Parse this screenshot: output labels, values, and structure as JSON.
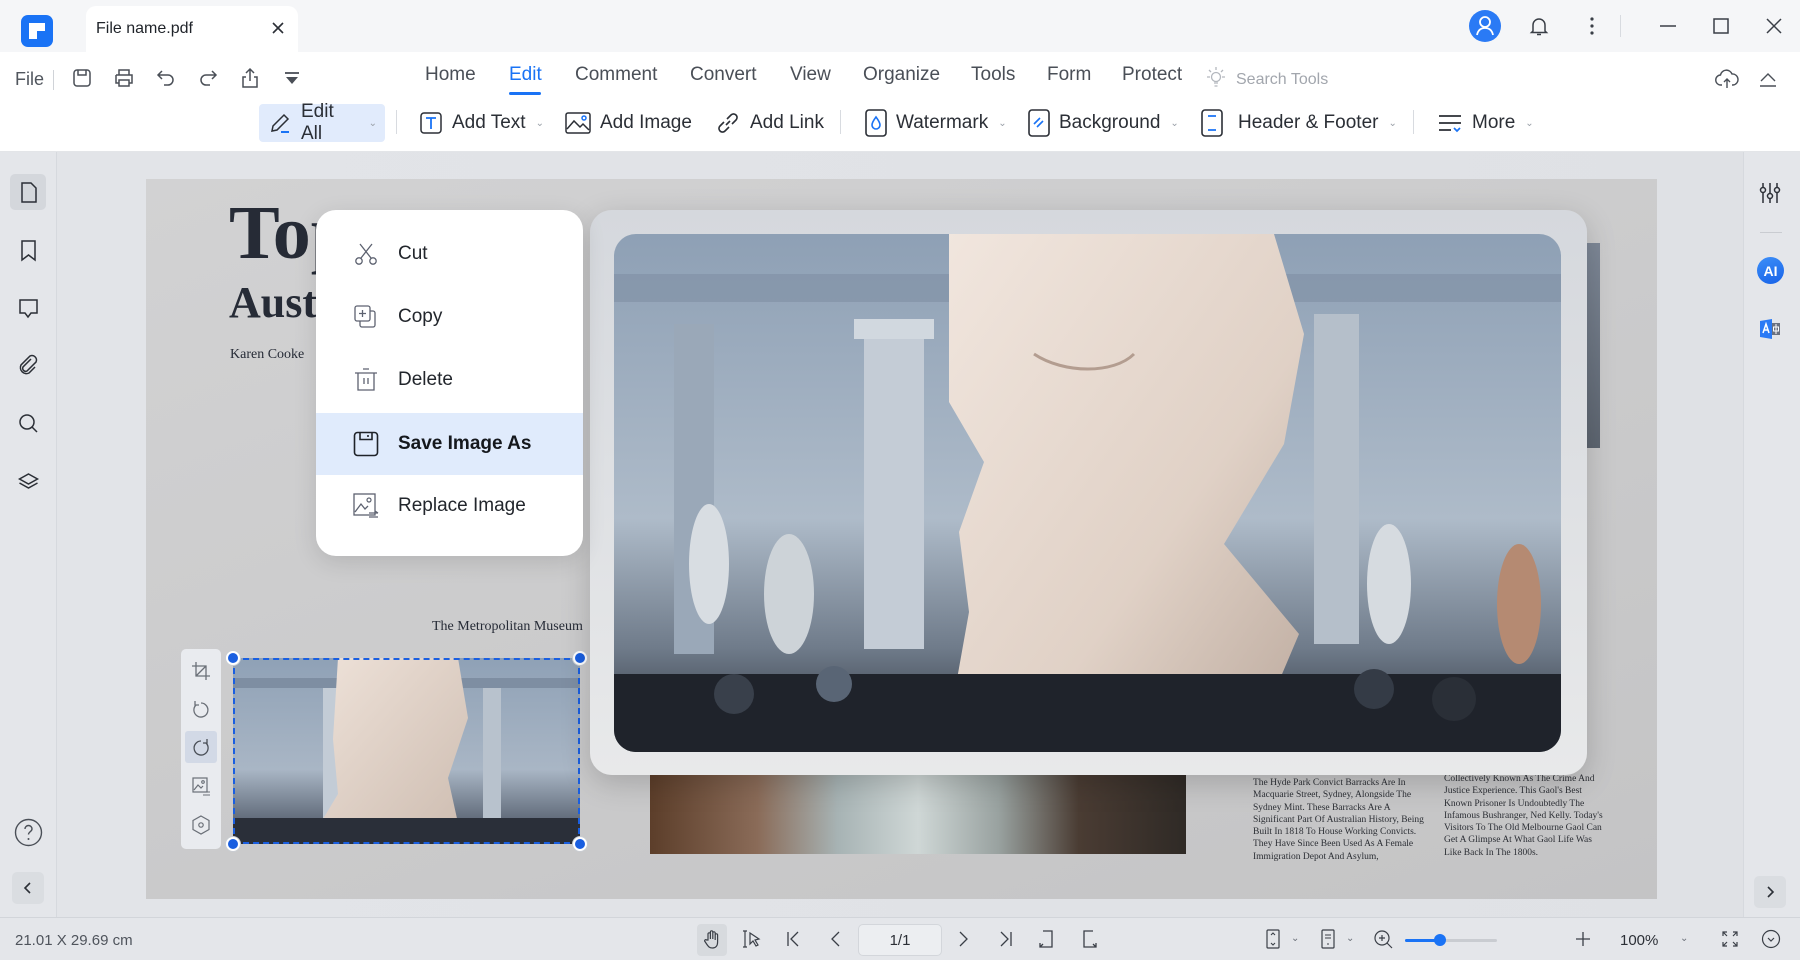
{
  "window": {
    "tab_title": "File name.pdf",
    "controls": [
      "minimize",
      "maximize",
      "close"
    ]
  },
  "ribbon": {
    "file_label": "File",
    "quick_actions": [
      "save-icon",
      "print-icon",
      "undo-icon",
      "redo-icon",
      "share-icon",
      "customize-icon"
    ],
    "menu_tabs": [
      {
        "label": "Home"
      },
      {
        "label": "Edit",
        "active": true
      },
      {
        "label": "Comment"
      },
      {
        "label": "Convert"
      },
      {
        "label": "View"
      },
      {
        "label": "Organize"
      },
      {
        "label": "Tools"
      },
      {
        "label": "Form"
      },
      {
        "label": "Protect"
      }
    ],
    "search_placeholder": "Search Tools",
    "tools": {
      "edit_all": "Edit All",
      "add_text": "Add Text",
      "add_image": "Add Image",
      "add_link": "Add Link",
      "watermark": "Watermark",
      "background": "Background",
      "header_footer": "Header & Footer",
      "more": "More"
    },
    "caret": "⌄"
  },
  "document": {
    "title": "Top",
    "subtitle": "Austr",
    "author": "Karen Cooke",
    "image_caption": "The Metropolitan Museum",
    "paragraph_1": "The Hyde Park Convict Barracks Are In Macquarie Street, Sydney, Alongside The Sydney Mint. These Barracks Are A Significant Part Of Australian History, Being Built In 1818 To House Working Convicts. They Have Since Been Used As A Female Immigration Depot And Asylum,",
    "paragraph_2": "Collectively Known As The Crime And Justice Experience. This Gaol's Best Known Prisoner Is Undoubtedly The Infamous Bushranger, Ned Kelly. Today's Visitors To The Old Melbourne Gaol Can Get A Glimpse At What Gaol Life Was Like Back In The 1800s."
  },
  "context_menu": {
    "items": [
      {
        "label": "Cut",
        "icon": "scissors-icon"
      },
      {
        "label": "Copy",
        "icon": "copy-icon"
      },
      {
        "label": "Delete",
        "icon": "trash-icon"
      },
      {
        "label": "Save Image As",
        "icon": "save-icon",
        "highlighted": true
      },
      {
        "label": "Replace Image",
        "icon": "replace-image-icon"
      }
    ]
  },
  "image_toolbar": [
    "crop-icon",
    "rotate-left-icon",
    "rotate-right-icon",
    "replace-image-icon",
    "settings-icon"
  ],
  "right_panel": {
    "ai_label": "AI"
  },
  "status_bar": {
    "page_dimensions": "21.01 X 29.69 cm",
    "page_indicator": "1/1",
    "zoom_percent": "100%",
    "zoom_slider_fraction": 0.38
  },
  "colors": {
    "accent": "#1a73f5",
    "selection": "#1a5fe0",
    "menu_highlight": "#e0ebfc"
  }
}
